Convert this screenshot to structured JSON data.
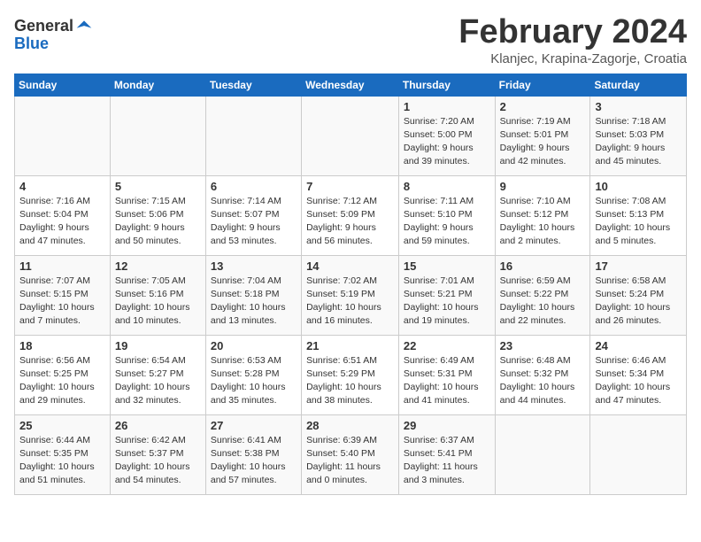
{
  "header": {
    "logo_general": "General",
    "logo_blue": "Blue",
    "title": "February 2024",
    "subtitle": "Klanjec, Krapina-Zagorje, Croatia"
  },
  "calendar": {
    "days_of_week": [
      "Sunday",
      "Monday",
      "Tuesday",
      "Wednesday",
      "Thursday",
      "Friday",
      "Saturday"
    ],
    "weeks": [
      [
        {
          "day": "",
          "info": ""
        },
        {
          "day": "",
          "info": ""
        },
        {
          "day": "",
          "info": ""
        },
        {
          "day": "",
          "info": ""
        },
        {
          "day": "1",
          "info": "Sunrise: 7:20 AM\nSunset: 5:00 PM\nDaylight: 9 hours\nand 39 minutes."
        },
        {
          "day": "2",
          "info": "Sunrise: 7:19 AM\nSunset: 5:01 PM\nDaylight: 9 hours\nand 42 minutes."
        },
        {
          "day": "3",
          "info": "Sunrise: 7:18 AM\nSunset: 5:03 PM\nDaylight: 9 hours\nand 45 minutes."
        }
      ],
      [
        {
          "day": "4",
          "info": "Sunrise: 7:16 AM\nSunset: 5:04 PM\nDaylight: 9 hours\nand 47 minutes."
        },
        {
          "day": "5",
          "info": "Sunrise: 7:15 AM\nSunset: 5:06 PM\nDaylight: 9 hours\nand 50 minutes."
        },
        {
          "day": "6",
          "info": "Sunrise: 7:14 AM\nSunset: 5:07 PM\nDaylight: 9 hours\nand 53 minutes."
        },
        {
          "day": "7",
          "info": "Sunrise: 7:12 AM\nSunset: 5:09 PM\nDaylight: 9 hours\nand 56 minutes."
        },
        {
          "day": "8",
          "info": "Sunrise: 7:11 AM\nSunset: 5:10 PM\nDaylight: 9 hours\nand 59 minutes."
        },
        {
          "day": "9",
          "info": "Sunrise: 7:10 AM\nSunset: 5:12 PM\nDaylight: 10 hours\nand 2 minutes."
        },
        {
          "day": "10",
          "info": "Sunrise: 7:08 AM\nSunset: 5:13 PM\nDaylight: 10 hours\nand 5 minutes."
        }
      ],
      [
        {
          "day": "11",
          "info": "Sunrise: 7:07 AM\nSunset: 5:15 PM\nDaylight: 10 hours\nand 7 minutes."
        },
        {
          "day": "12",
          "info": "Sunrise: 7:05 AM\nSunset: 5:16 PM\nDaylight: 10 hours\nand 10 minutes."
        },
        {
          "day": "13",
          "info": "Sunrise: 7:04 AM\nSunset: 5:18 PM\nDaylight: 10 hours\nand 13 minutes."
        },
        {
          "day": "14",
          "info": "Sunrise: 7:02 AM\nSunset: 5:19 PM\nDaylight: 10 hours\nand 16 minutes."
        },
        {
          "day": "15",
          "info": "Sunrise: 7:01 AM\nSunset: 5:21 PM\nDaylight: 10 hours\nand 19 minutes."
        },
        {
          "day": "16",
          "info": "Sunrise: 6:59 AM\nSunset: 5:22 PM\nDaylight: 10 hours\nand 22 minutes."
        },
        {
          "day": "17",
          "info": "Sunrise: 6:58 AM\nSunset: 5:24 PM\nDaylight: 10 hours\nand 26 minutes."
        }
      ],
      [
        {
          "day": "18",
          "info": "Sunrise: 6:56 AM\nSunset: 5:25 PM\nDaylight: 10 hours\nand 29 minutes."
        },
        {
          "day": "19",
          "info": "Sunrise: 6:54 AM\nSunset: 5:27 PM\nDaylight: 10 hours\nand 32 minutes."
        },
        {
          "day": "20",
          "info": "Sunrise: 6:53 AM\nSunset: 5:28 PM\nDaylight: 10 hours\nand 35 minutes."
        },
        {
          "day": "21",
          "info": "Sunrise: 6:51 AM\nSunset: 5:29 PM\nDaylight: 10 hours\nand 38 minutes."
        },
        {
          "day": "22",
          "info": "Sunrise: 6:49 AM\nSunset: 5:31 PM\nDaylight: 10 hours\nand 41 minutes."
        },
        {
          "day": "23",
          "info": "Sunrise: 6:48 AM\nSunset: 5:32 PM\nDaylight: 10 hours\nand 44 minutes."
        },
        {
          "day": "24",
          "info": "Sunrise: 6:46 AM\nSunset: 5:34 PM\nDaylight: 10 hours\nand 47 minutes."
        }
      ],
      [
        {
          "day": "25",
          "info": "Sunrise: 6:44 AM\nSunset: 5:35 PM\nDaylight: 10 hours\nand 51 minutes."
        },
        {
          "day": "26",
          "info": "Sunrise: 6:42 AM\nSunset: 5:37 PM\nDaylight: 10 hours\nand 54 minutes."
        },
        {
          "day": "27",
          "info": "Sunrise: 6:41 AM\nSunset: 5:38 PM\nDaylight: 10 hours\nand 57 minutes."
        },
        {
          "day": "28",
          "info": "Sunrise: 6:39 AM\nSunset: 5:40 PM\nDaylight: 11 hours\nand 0 minutes."
        },
        {
          "day": "29",
          "info": "Sunrise: 6:37 AM\nSunset: 5:41 PM\nDaylight: 11 hours\nand 3 minutes."
        },
        {
          "day": "",
          "info": ""
        },
        {
          "day": "",
          "info": ""
        }
      ]
    ]
  }
}
